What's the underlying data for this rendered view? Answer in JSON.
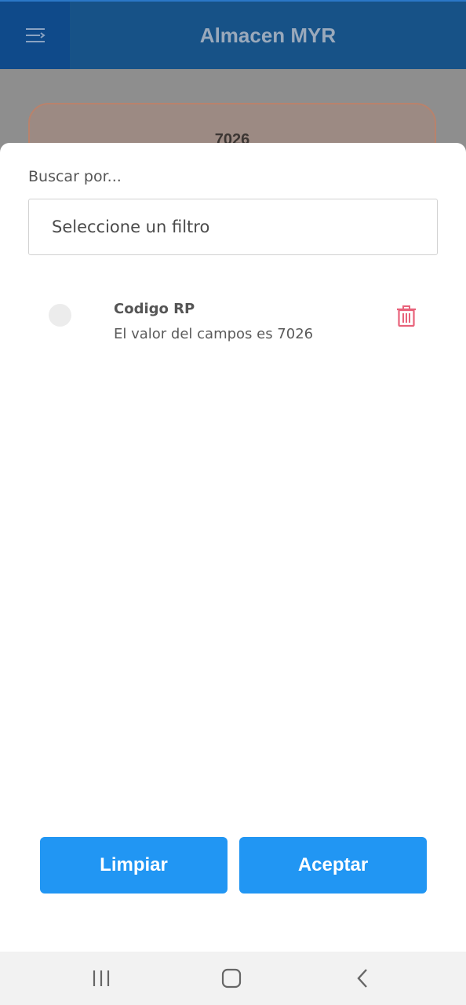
{
  "header": {
    "title": "Almacen MYR",
    "menu_icon": "menu-icon"
  },
  "background_card": {
    "code": "7026"
  },
  "filter_sheet": {
    "search_label": "Buscar por...",
    "filter_placeholder": "Seleccione un filtro",
    "items": [
      {
        "title": "Codigo RP",
        "description": "El valor del campos es 7026",
        "delete_icon": "trash-icon"
      }
    ],
    "clear_label": "Limpiar",
    "accept_label": "Aceptar"
  },
  "colors": {
    "header": "#175287",
    "menu_button": "#0f4a8a",
    "primary_button": "#2196f3",
    "delete_icon": "#e8627a",
    "overlay": "#8e8e8e"
  },
  "android_nav": {
    "recents_icon": "recents-icon",
    "home_icon": "home-icon",
    "back_icon": "back-icon"
  }
}
